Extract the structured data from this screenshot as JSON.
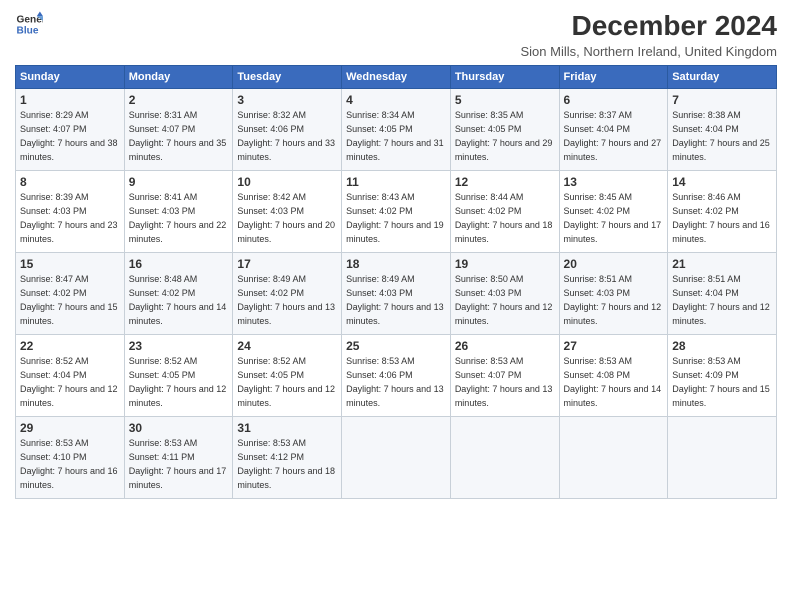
{
  "header": {
    "logo_line1": "General",
    "logo_line2": "Blue",
    "title": "December 2024",
    "subtitle": "Sion Mills, Northern Ireland, United Kingdom"
  },
  "weekdays": [
    "Sunday",
    "Monday",
    "Tuesday",
    "Wednesday",
    "Thursday",
    "Friday",
    "Saturday"
  ],
  "weeks": [
    [
      {
        "day": "1",
        "sunrise": "Sunrise: 8:29 AM",
        "sunset": "Sunset: 4:07 PM",
        "daylight": "Daylight: 7 hours and 38 minutes."
      },
      {
        "day": "2",
        "sunrise": "Sunrise: 8:31 AM",
        "sunset": "Sunset: 4:07 PM",
        "daylight": "Daylight: 7 hours and 35 minutes."
      },
      {
        "day": "3",
        "sunrise": "Sunrise: 8:32 AM",
        "sunset": "Sunset: 4:06 PM",
        "daylight": "Daylight: 7 hours and 33 minutes."
      },
      {
        "day": "4",
        "sunrise": "Sunrise: 8:34 AM",
        "sunset": "Sunset: 4:05 PM",
        "daylight": "Daylight: 7 hours and 31 minutes."
      },
      {
        "day": "5",
        "sunrise": "Sunrise: 8:35 AM",
        "sunset": "Sunset: 4:05 PM",
        "daylight": "Daylight: 7 hours and 29 minutes."
      },
      {
        "day": "6",
        "sunrise": "Sunrise: 8:37 AM",
        "sunset": "Sunset: 4:04 PM",
        "daylight": "Daylight: 7 hours and 27 minutes."
      },
      {
        "day": "7",
        "sunrise": "Sunrise: 8:38 AM",
        "sunset": "Sunset: 4:04 PM",
        "daylight": "Daylight: 7 hours and 25 minutes."
      }
    ],
    [
      {
        "day": "8",
        "sunrise": "Sunrise: 8:39 AM",
        "sunset": "Sunset: 4:03 PM",
        "daylight": "Daylight: 7 hours and 23 minutes."
      },
      {
        "day": "9",
        "sunrise": "Sunrise: 8:41 AM",
        "sunset": "Sunset: 4:03 PM",
        "daylight": "Daylight: 7 hours and 22 minutes."
      },
      {
        "day": "10",
        "sunrise": "Sunrise: 8:42 AM",
        "sunset": "Sunset: 4:03 PM",
        "daylight": "Daylight: 7 hours and 20 minutes."
      },
      {
        "day": "11",
        "sunrise": "Sunrise: 8:43 AM",
        "sunset": "Sunset: 4:02 PM",
        "daylight": "Daylight: 7 hours and 19 minutes."
      },
      {
        "day": "12",
        "sunrise": "Sunrise: 8:44 AM",
        "sunset": "Sunset: 4:02 PM",
        "daylight": "Daylight: 7 hours and 18 minutes."
      },
      {
        "day": "13",
        "sunrise": "Sunrise: 8:45 AM",
        "sunset": "Sunset: 4:02 PM",
        "daylight": "Daylight: 7 hours and 17 minutes."
      },
      {
        "day": "14",
        "sunrise": "Sunrise: 8:46 AM",
        "sunset": "Sunset: 4:02 PM",
        "daylight": "Daylight: 7 hours and 16 minutes."
      }
    ],
    [
      {
        "day": "15",
        "sunrise": "Sunrise: 8:47 AM",
        "sunset": "Sunset: 4:02 PM",
        "daylight": "Daylight: 7 hours and 15 minutes."
      },
      {
        "day": "16",
        "sunrise": "Sunrise: 8:48 AM",
        "sunset": "Sunset: 4:02 PM",
        "daylight": "Daylight: 7 hours and 14 minutes."
      },
      {
        "day": "17",
        "sunrise": "Sunrise: 8:49 AM",
        "sunset": "Sunset: 4:02 PM",
        "daylight": "Daylight: 7 hours and 13 minutes."
      },
      {
        "day": "18",
        "sunrise": "Sunrise: 8:49 AM",
        "sunset": "Sunset: 4:03 PM",
        "daylight": "Daylight: 7 hours and 13 minutes."
      },
      {
        "day": "19",
        "sunrise": "Sunrise: 8:50 AM",
        "sunset": "Sunset: 4:03 PM",
        "daylight": "Daylight: 7 hours and 12 minutes."
      },
      {
        "day": "20",
        "sunrise": "Sunrise: 8:51 AM",
        "sunset": "Sunset: 4:03 PM",
        "daylight": "Daylight: 7 hours and 12 minutes."
      },
      {
        "day": "21",
        "sunrise": "Sunrise: 8:51 AM",
        "sunset": "Sunset: 4:04 PM",
        "daylight": "Daylight: 7 hours and 12 minutes."
      }
    ],
    [
      {
        "day": "22",
        "sunrise": "Sunrise: 8:52 AM",
        "sunset": "Sunset: 4:04 PM",
        "daylight": "Daylight: 7 hours and 12 minutes."
      },
      {
        "day": "23",
        "sunrise": "Sunrise: 8:52 AM",
        "sunset": "Sunset: 4:05 PM",
        "daylight": "Daylight: 7 hours and 12 minutes."
      },
      {
        "day": "24",
        "sunrise": "Sunrise: 8:52 AM",
        "sunset": "Sunset: 4:05 PM",
        "daylight": "Daylight: 7 hours and 12 minutes."
      },
      {
        "day": "25",
        "sunrise": "Sunrise: 8:53 AM",
        "sunset": "Sunset: 4:06 PM",
        "daylight": "Daylight: 7 hours and 13 minutes."
      },
      {
        "day": "26",
        "sunrise": "Sunrise: 8:53 AM",
        "sunset": "Sunset: 4:07 PM",
        "daylight": "Daylight: 7 hours and 13 minutes."
      },
      {
        "day": "27",
        "sunrise": "Sunrise: 8:53 AM",
        "sunset": "Sunset: 4:08 PM",
        "daylight": "Daylight: 7 hours and 14 minutes."
      },
      {
        "day": "28",
        "sunrise": "Sunrise: 8:53 AM",
        "sunset": "Sunset: 4:09 PM",
        "daylight": "Daylight: 7 hours and 15 minutes."
      }
    ],
    [
      {
        "day": "29",
        "sunrise": "Sunrise: 8:53 AM",
        "sunset": "Sunset: 4:10 PM",
        "daylight": "Daylight: 7 hours and 16 minutes."
      },
      {
        "day": "30",
        "sunrise": "Sunrise: 8:53 AM",
        "sunset": "Sunset: 4:11 PM",
        "daylight": "Daylight: 7 hours and 17 minutes."
      },
      {
        "day": "31",
        "sunrise": "Sunrise: 8:53 AM",
        "sunset": "Sunset: 4:12 PM",
        "daylight": "Daylight: 7 hours and 18 minutes."
      },
      null,
      null,
      null,
      null
    ]
  ]
}
